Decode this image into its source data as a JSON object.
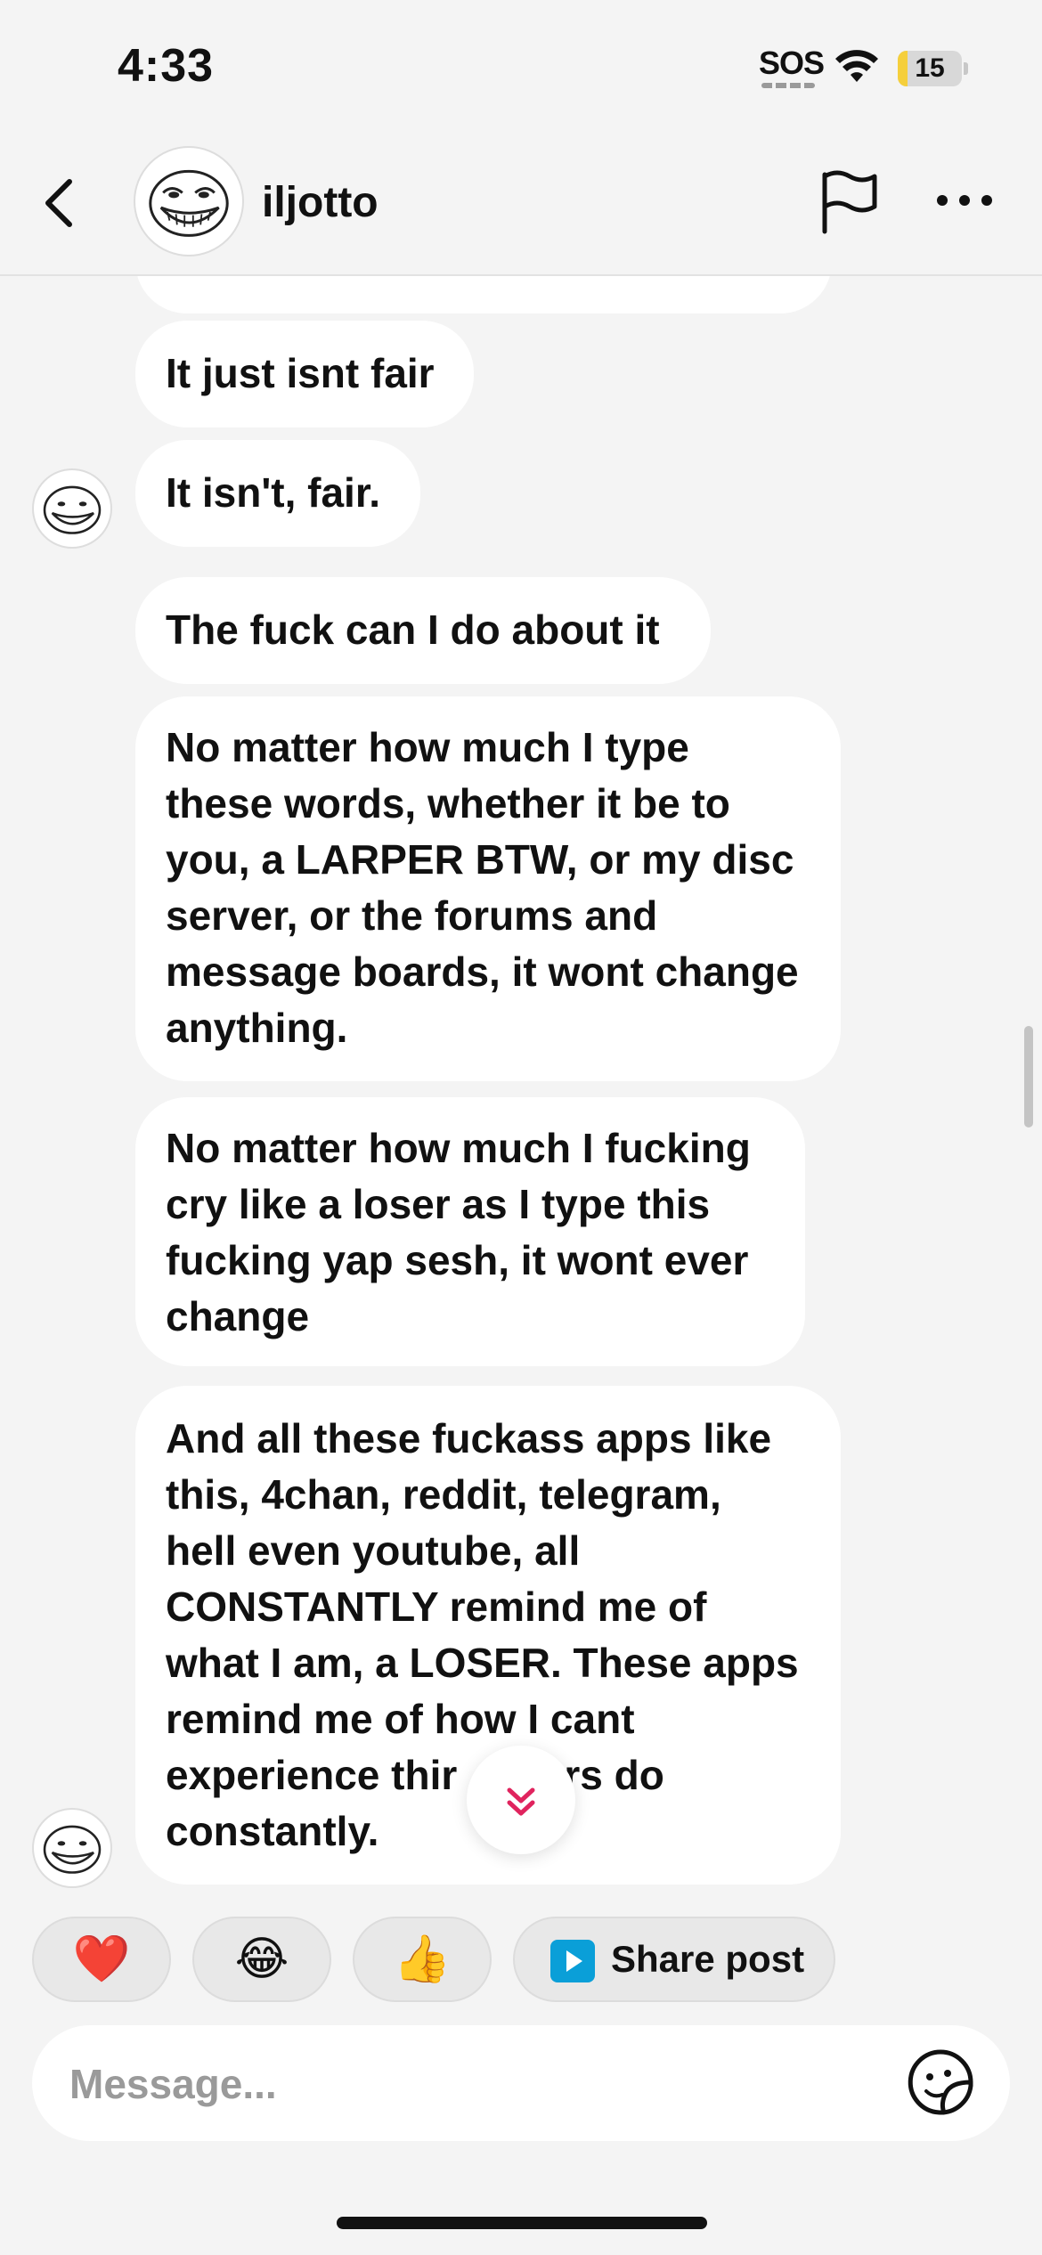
{
  "status_bar": {
    "time": "4:33",
    "sos": "SOS",
    "battery": "15",
    "battery_level": 0.15
  },
  "header": {
    "username": "iljotto"
  },
  "messages": [
    {
      "text": "It just isnt fair"
    },
    {
      "text": "It isn't, fair."
    },
    {
      "text": "The fuck can I do about it"
    },
    {
      "text": "No matter how much I type these words, whether it be to you, a LARPER BTW, or my disc server, or the forums and message boards, it wont change anything.",
      "lines": [
        "No matter how much I type",
        "these words, whether it be to",
        "you, a LARPER BTW, or my disc",
        "server, or the forums and",
        "message boards, it wont change",
        "anything."
      ]
    },
    {
      "text": "No matter how much I fucking cry like a loser as I type this fucking yap sesh, it wont ever change",
      "lines": [
        "No matter how much I fucking",
        "cry like a loser as I type this",
        "fucking yap sesh, it wont ever",
        "change"
      ]
    },
    {
      "text": "And all these fuckass apps like this, 4chan, reddit, telegram, hell even youtube, all CONSTANTLY remind me of what I am, a LOSER. These apps remind me of how I cant experience thin… others do constantly.",
      "lines": [
        "And all these fuckass apps like",
        "this, 4chan, reddit, telegram,",
        "hell even youtube, all",
        "CONSTANTLY remind me of",
        "what I am, a LOSER. These apps",
        "remind me of how I cant",
        "experience thir    thers do",
        "constantly."
      ]
    }
  ],
  "quick_replies": [
    {
      "emoji": "❤️",
      "name": "heart"
    },
    {
      "emoji": "😂",
      "name": "laughing"
    },
    {
      "emoji": "👍",
      "name": "thumbs-up"
    }
  ],
  "share_post": {
    "label": "Share post"
  },
  "composer": {
    "placeholder": "Message..."
  },
  "colors": {
    "background": "#f4f4f4",
    "bubble": "#ffffff",
    "accent": "#e0245e",
    "share_icon": "#0a9fd8",
    "battery_fill": "#f5cf3c"
  }
}
